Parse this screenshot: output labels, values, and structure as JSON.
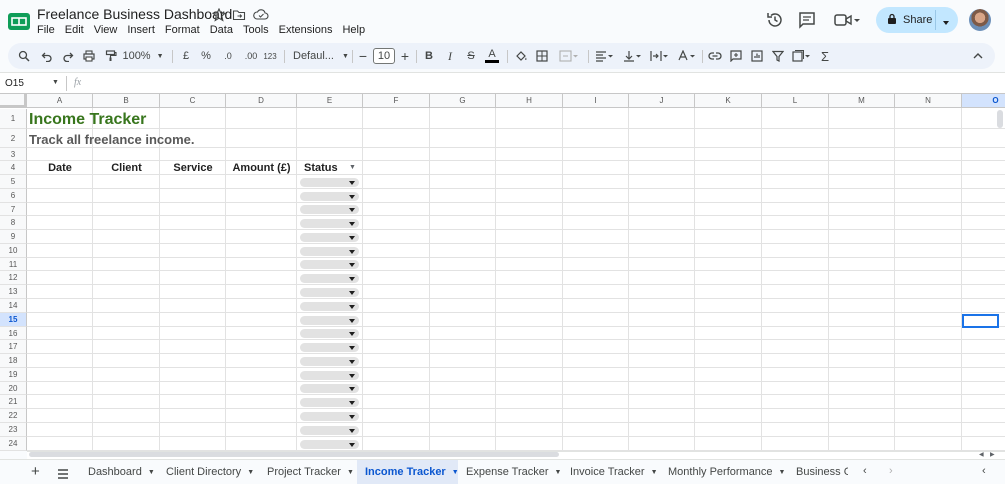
{
  "app": {
    "title": "Freelance Business Dashboard",
    "menus": [
      "File",
      "Edit",
      "View",
      "Insert",
      "Format",
      "Data",
      "Tools",
      "Extensions",
      "Help"
    ],
    "share_label": "Share",
    "accent": "#c2e7ff",
    "brand_green": "#0f9d58"
  },
  "toolbar": {
    "zoom": "100%",
    "currency": "£",
    "percent": "%",
    "dec_less": ".0",
    "dec_more": ".00",
    "number_format": "123",
    "font": "Defaul...",
    "font_size": "10",
    "bold": "B",
    "italic": "I",
    "strike": "S",
    "text_color": "A",
    "text_color_value": "#000000"
  },
  "formula_bar": {
    "cell_ref": "O15",
    "fx": "fx",
    "value": ""
  },
  "columns": [
    "A",
    "B",
    "C",
    "D",
    "E",
    "F",
    "G",
    "H",
    "I",
    "J",
    "K",
    "L",
    "M",
    "N",
    "O"
  ],
  "rows": [
    "1",
    "2",
    "3",
    "4",
    "5",
    "6",
    "7",
    "8",
    "9",
    "10",
    "11",
    "12",
    "13",
    "14",
    "15",
    "16",
    "17",
    "18",
    "19",
    "20",
    "21",
    "22",
    "23",
    "24"
  ],
  "sheet": {
    "title": "Income Tracker",
    "subtitle": "Track all freelance income.",
    "headers": [
      "Date",
      "Client",
      "Service",
      "Amount (£)",
      "Status"
    ],
    "title_color": "#38761d",
    "status_dropdowns": 20
  },
  "selected_cell": "O15",
  "tabs": [
    {
      "label": "Dashboard",
      "active": false
    },
    {
      "label": "Client Directory",
      "active": false
    },
    {
      "label": "Project Tracker",
      "active": false
    },
    {
      "label": "Income Tracker",
      "active": true
    },
    {
      "label": "Expense Tracker",
      "active": false
    },
    {
      "label": "Invoice Tracker",
      "active": false
    },
    {
      "label": "Monthly Performance",
      "active": false
    },
    {
      "label": "Business Go",
      "active": false
    }
  ]
}
